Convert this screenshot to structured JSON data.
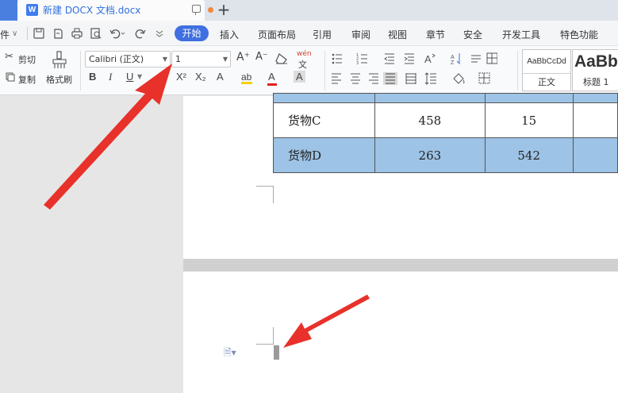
{
  "titlebar": {
    "doc_icon_letter": "W",
    "doc_name": "新建 DOCX 文档.docx",
    "new_tab": "+"
  },
  "menu": {
    "file_fragment": "件",
    "file_caret": "∨",
    "tabs": [
      "开始",
      "插入",
      "页面布局",
      "引用",
      "审阅",
      "视图",
      "章节",
      "安全",
      "开发工具",
      "特色功能"
    ]
  },
  "ribbon": {
    "cut": "剪切",
    "copy": "复制",
    "format_painter": "格式刷",
    "font_name": "Calibri (正文)",
    "font_size": "1",
    "bold": "B",
    "italic": "I",
    "underline": "U",
    "superscript": "X²",
    "subscript": "X₂",
    "font_size_grow": "A⁺",
    "font_size_shrink": "A⁻",
    "text_effect": "A",
    "font_color": "A",
    "char_shade": "A",
    "phonetic": "wén",
    "styles": [
      {
        "sample": "AaBbCcDd",
        "label": "正文"
      },
      {
        "sample": "AaBb",
        "label": "标题 1"
      }
    ]
  },
  "table": {
    "rows": [
      {
        "name": "货物C",
        "v1": "458",
        "v2": "15"
      },
      {
        "name": "货物D",
        "v1": "263",
        "v2": "542"
      }
    ]
  },
  "colors": {
    "accent": "#3f6fe0",
    "table_highlight": "#9dc3e6",
    "arrow": "#e8312a",
    "tab_dot": "#f0883a"
  }
}
